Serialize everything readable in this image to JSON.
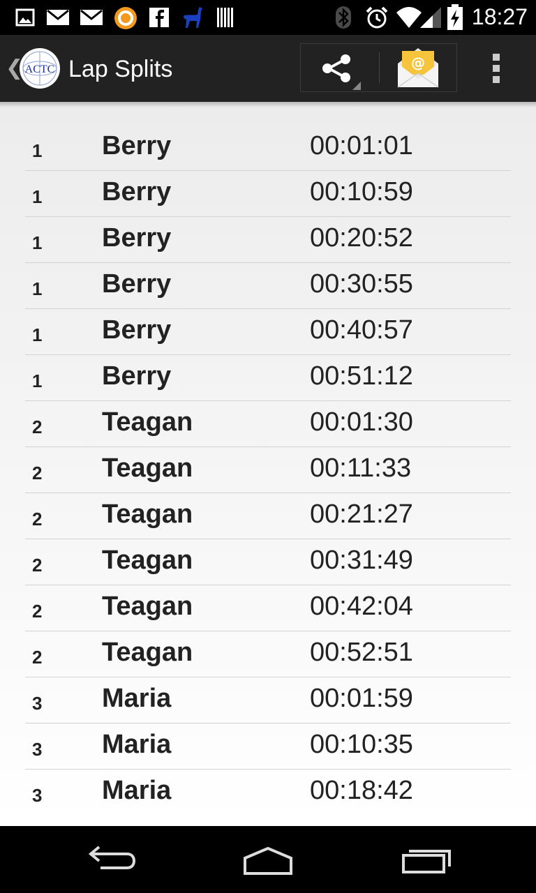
{
  "status_bar": {
    "time": "18:27",
    "left_icons": [
      "picture-icon",
      "gmail-icon",
      "gmail-icon",
      "audible-icon",
      "facebook-icon",
      "llama-icon",
      "barcode-icon"
    ],
    "right_icons": [
      "bluetooth-icon",
      "alarm-icon",
      "wifi-icon",
      "signal-icon",
      "battery-icon"
    ]
  },
  "action_bar": {
    "title": "Lap Splits",
    "logo_text": "ACTC",
    "actions": [
      "share-icon",
      "email-icon",
      "overflow-menu-icon"
    ]
  },
  "splits": [
    {
      "lap": "1",
      "name": "Berry",
      "time": "00:01:01"
    },
    {
      "lap": "1",
      "name": "Berry",
      "time": "00:10:59"
    },
    {
      "lap": "1",
      "name": "Berry",
      "time": "00:20:52"
    },
    {
      "lap": "1",
      "name": "Berry",
      "time": "00:30:55"
    },
    {
      "lap": "1",
      "name": "Berry",
      "time": "00:40:57"
    },
    {
      "lap": "1",
      "name": "Berry",
      "time": "00:51:12"
    },
    {
      "lap": "2",
      "name": "Teagan",
      "time": "00:01:30"
    },
    {
      "lap": "2",
      "name": "Teagan",
      "time": "00:11:33"
    },
    {
      "lap": "2",
      "name": "Teagan",
      "time": "00:21:27"
    },
    {
      "lap": "2",
      "name": "Teagan",
      "time": "00:31:49"
    },
    {
      "lap": "2",
      "name": "Teagan",
      "time": "00:42:04"
    },
    {
      "lap": "2",
      "name": "Teagan",
      "time": "00:52:51"
    },
    {
      "lap": "3",
      "name": "Maria",
      "time": "00:01:59"
    },
    {
      "lap": "3",
      "name": "Maria",
      "time": "00:10:35"
    },
    {
      "lap": "3",
      "name": "Maria",
      "time": "00:18:42"
    }
  ],
  "nav_bar": {
    "buttons": [
      "back-icon",
      "home-icon",
      "recents-icon"
    ]
  },
  "colors": {
    "status_bar_bg": "#000000",
    "action_bar_bg": "#222222",
    "list_text": "#222222",
    "divider": "#d2d2d2"
  }
}
